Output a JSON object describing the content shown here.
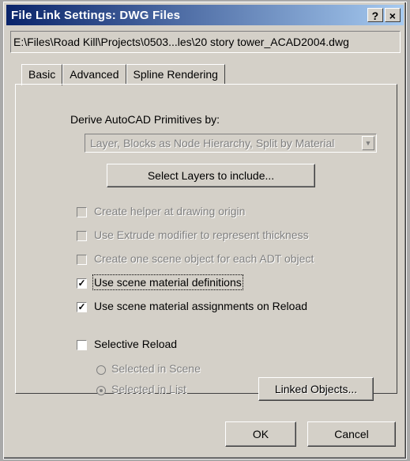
{
  "window": {
    "title": "File Link Settings: DWG Files",
    "help_label": "?",
    "close_label": "×"
  },
  "path": "E:\\Files\\Road Kill\\Projects\\0503...les\\20 story tower_ACAD2004.dwg",
  "tabs": [
    {
      "label": "Basic",
      "active": true
    },
    {
      "label": "Advanced",
      "active": false
    },
    {
      "label": "Spline Rendering",
      "active": false
    }
  ],
  "derive": {
    "label": "Derive AutoCAD Primitives by:",
    "value": "Layer, Blocks as Node Hierarchy, Split by Material"
  },
  "select_layers_button": "Select Layers to include...",
  "options": [
    {
      "label": "Create helper at drawing origin",
      "checked": false,
      "enabled": false
    },
    {
      "label": "Use Extrude modifier to represent thickness",
      "checked": false,
      "enabled": false
    },
    {
      "label": "Create one scene object for each ADT object",
      "checked": false,
      "enabled": false
    },
    {
      "label": "Use scene material definitions",
      "checked": true,
      "enabled": true
    },
    {
      "label": "Use scene material assignments on Reload",
      "checked": true,
      "enabled": true
    }
  ],
  "selective_reload": {
    "label": "Selective Reload",
    "checked": false,
    "radios": [
      {
        "label": "Selected in Scene",
        "selected": false
      },
      {
        "label": "Selected in List",
        "selected": true
      }
    ],
    "linked_objects_button": "Linked Objects..."
  },
  "footer": {
    "ok_label": "OK",
    "cancel_label": "Cancel"
  }
}
